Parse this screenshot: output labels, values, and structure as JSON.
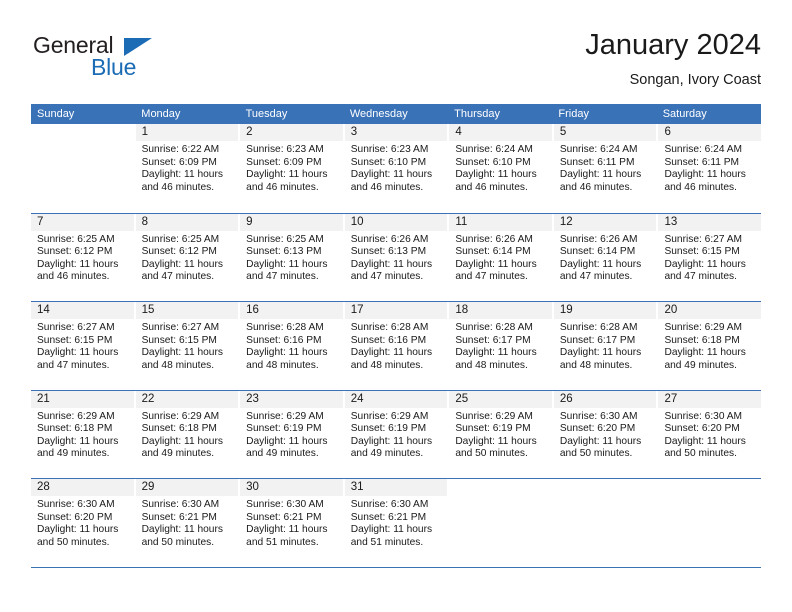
{
  "logo": {
    "word_one": "General",
    "word_two": "Blue",
    "triangle_icon": "triangle-icon",
    "brand_blue": "#1b6cb5",
    "brand_dark": "#231f20"
  },
  "header": {
    "title": "January 2024",
    "subtitle": "Songan, Ivory Coast"
  },
  "theme": {
    "header_blue": "#3a72b8",
    "daynum_background": "#f2f2f2",
    "text": "#1a1a1a"
  },
  "calendar": {
    "weekdays": [
      "Sunday",
      "Monday",
      "Tuesday",
      "Wednesday",
      "Thursday",
      "Friday",
      "Saturday"
    ],
    "weeks": [
      [
        {
          "day": "",
          "sunrise": "",
          "sunset": "",
          "daylight_1": "",
          "daylight_2": "",
          "empty": true
        },
        {
          "day": "1",
          "sunrise": "Sunrise: 6:22 AM",
          "sunset": "Sunset: 6:09 PM",
          "daylight_1": "Daylight: 11 hours",
          "daylight_2": "and 46 minutes."
        },
        {
          "day": "2",
          "sunrise": "Sunrise: 6:23 AM",
          "sunset": "Sunset: 6:09 PM",
          "daylight_1": "Daylight: 11 hours",
          "daylight_2": "and 46 minutes."
        },
        {
          "day": "3",
          "sunrise": "Sunrise: 6:23 AM",
          "sunset": "Sunset: 6:10 PM",
          "daylight_1": "Daylight: 11 hours",
          "daylight_2": "and 46 minutes."
        },
        {
          "day": "4",
          "sunrise": "Sunrise: 6:24 AM",
          "sunset": "Sunset: 6:10 PM",
          "daylight_1": "Daylight: 11 hours",
          "daylight_2": "and 46 minutes."
        },
        {
          "day": "5",
          "sunrise": "Sunrise: 6:24 AM",
          "sunset": "Sunset: 6:11 PM",
          "daylight_1": "Daylight: 11 hours",
          "daylight_2": "and 46 minutes."
        },
        {
          "day": "6",
          "sunrise": "Sunrise: 6:24 AM",
          "sunset": "Sunset: 6:11 PM",
          "daylight_1": "Daylight: 11 hours",
          "daylight_2": "and 46 minutes."
        }
      ],
      [
        {
          "day": "7",
          "sunrise": "Sunrise: 6:25 AM",
          "sunset": "Sunset: 6:12 PM",
          "daylight_1": "Daylight: 11 hours",
          "daylight_2": "and 46 minutes."
        },
        {
          "day": "8",
          "sunrise": "Sunrise: 6:25 AM",
          "sunset": "Sunset: 6:12 PM",
          "daylight_1": "Daylight: 11 hours",
          "daylight_2": "and 47 minutes."
        },
        {
          "day": "9",
          "sunrise": "Sunrise: 6:25 AM",
          "sunset": "Sunset: 6:13 PM",
          "daylight_1": "Daylight: 11 hours",
          "daylight_2": "and 47 minutes."
        },
        {
          "day": "10",
          "sunrise": "Sunrise: 6:26 AM",
          "sunset": "Sunset: 6:13 PM",
          "daylight_1": "Daylight: 11 hours",
          "daylight_2": "and 47 minutes."
        },
        {
          "day": "11",
          "sunrise": "Sunrise: 6:26 AM",
          "sunset": "Sunset: 6:14 PM",
          "daylight_1": "Daylight: 11 hours",
          "daylight_2": "and 47 minutes."
        },
        {
          "day": "12",
          "sunrise": "Sunrise: 6:26 AM",
          "sunset": "Sunset: 6:14 PM",
          "daylight_1": "Daylight: 11 hours",
          "daylight_2": "and 47 minutes."
        },
        {
          "day": "13",
          "sunrise": "Sunrise: 6:27 AM",
          "sunset": "Sunset: 6:15 PM",
          "daylight_1": "Daylight: 11 hours",
          "daylight_2": "and 47 minutes."
        }
      ],
      [
        {
          "day": "14",
          "sunrise": "Sunrise: 6:27 AM",
          "sunset": "Sunset: 6:15 PM",
          "daylight_1": "Daylight: 11 hours",
          "daylight_2": "and 47 minutes."
        },
        {
          "day": "15",
          "sunrise": "Sunrise: 6:27 AM",
          "sunset": "Sunset: 6:15 PM",
          "daylight_1": "Daylight: 11 hours",
          "daylight_2": "and 48 minutes."
        },
        {
          "day": "16",
          "sunrise": "Sunrise: 6:28 AM",
          "sunset": "Sunset: 6:16 PM",
          "daylight_1": "Daylight: 11 hours",
          "daylight_2": "and 48 minutes."
        },
        {
          "day": "17",
          "sunrise": "Sunrise: 6:28 AM",
          "sunset": "Sunset: 6:16 PM",
          "daylight_1": "Daylight: 11 hours",
          "daylight_2": "and 48 minutes."
        },
        {
          "day": "18",
          "sunrise": "Sunrise: 6:28 AM",
          "sunset": "Sunset: 6:17 PM",
          "daylight_1": "Daylight: 11 hours",
          "daylight_2": "and 48 minutes."
        },
        {
          "day": "19",
          "sunrise": "Sunrise: 6:28 AM",
          "sunset": "Sunset: 6:17 PM",
          "daylight_1": "Daylight: 11 hours",
          "daylight_2": "and 48 minutes."
        },
        {
          "day": "20",
          "sunrise": "Sunrise: 6:29 AM",
          "sunset": "Sunset: 6:18 PM",
          "daylight_1": "Daylight: 11 hours",
          "daylight_2": "and 49 minutes."
        }
      ],
      [
        {
          "day": "21",
          "sunrise": "Sunrise: 6:29 AM",
          "sunset": "Sunset: 6:18 PM",
          "daylight_1": "Daylight: 11 hours",
          "daylight_2": "and 49 minutes."
        },
        {
          "day": "22",
          "sunrise": "Sunrise: 6:29 AM",
          "sunset": "Sunset: 6:18 PM",
          "daylight_1": "Daylight: 11 hours",
          "daylight_2": "and 49 minutes."
        },
        {
          "day": "23",
          "sunrise": "Sunrise: 6:29 AM",
          "sunset": "Sunset: 6:19 PM",
          "daylight_1": "Daylight: 11 hours",
          "daylight_2": "and 49 minutes."
        },
        {
          "day": "24",
          "sunrise": "Sunrise: 6:29 AM",
          "sunset": "Sunset: 6:19 PM",
          "daylight_1": "Daylight: 11 hours",
          "daylight_2": "and 49 minutes."
        },
        {
          "day": "25",
          "sunrise": "Sunrise: 6:29 AM",
          "sunset": "Sunset: 6:19 PM",
          "daylight_1": "Daylight: 11 hours",
          "daylight_2": "and 50 minutes."
        },
        {
          "day": "26",
          "sunrise": "Sunrise: 6:30 AM",
          "sunset": "Sunset: 6:20 PM",
          "daylight_1": "Daylight: 11 hours",
          "daylight_2": "and 50 minutes."
        },
        {
          "day": "27",
          "sunrise": "Sunrise: 6:30 AM",
          "sunset": "Sunset: 6:20 PM",
          "daylight_1": "Daylight: 11 hours",
          "daylight_2": "and 50 minutes."
        }
      ],
      [
        {
          "day": "28",
          "sunrise": "Sunrise: 6:30 AM",
          "sunset": "Sunset: 6:20 PM",
          "daylight_1": "Daylight: 11 hours",
          "daylight_2": "and 50 minutes."
        },
        {
          "day": "29",
          "sunrise": "Sunrise: 6:30 AM",
          "sunset": "Sunset: 6:21 PM",
          "daylight_1": "Daylight: 11 hours",
          "daylight_2": "and 50 minutes."
        },
        {
          "day": "30",
          "sunrise": "Sunrise: 6:30 AM",
          "sunset": "Sunset: 6:21 PM",
          "daylight_1": "Daylight: 11 hours",
          "daylight_2": "and 51 minutes."
        },
        {
          "day": "31",
          "sunrise": "Sunrise: 6:30 AM",
          "sunset": "Sunset: 6:21 PM",
          "daylight_1": "Daylight: 11 hours",
          "daylight_2": "and 51 minutes."
        },
        {
          "day": "",
          "sunrise": "",
          "sunset": "",
          "daylight_1": "",
          "daylight_2": "",
          "empty": true
        },
        {
          "day": "",
          "sunrise": "",
          "sunset": "",
          "daylight_1": "",
          "daylight_2": "",
          "empty": true
        },
        {
          "day": "",
          "sunrise": "",
          "sunset": "",
          "daylight_1": "",
          "daylight_2": "",
          "empty": true
        }
      ]
    ]
  }
}
